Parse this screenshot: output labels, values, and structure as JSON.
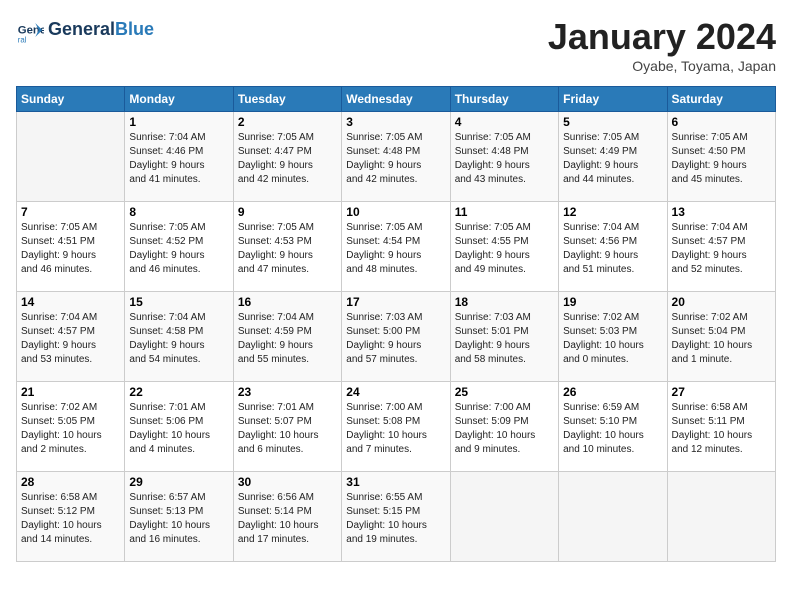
{
  "header": {
    "logo_line1": "General",
    "logo_line2": "Blue",
    "title": "January 2024",
    "subtitle": "Oyabe, Toyama, Japan"
  },
  "days_of_week": [
    "Sunday",
    "Monday",
    "Tuesday",
    "Wednesday",
    "Thursday",
    "Friday",
    "Saturday"
  ],
  "weeks": [
    [
      {
        "num": "",
        "info": ""
      },
      {
        "num": "1",
        "info": "Sunrise: 7:04 AM\nSunset: 4:46 PM\nDaylight: 9 hours\nand 41 minutes."
      },
      {
        "num": "2",
        "info": "Sunrise: 7:05 AM\nSunset: 4:47 PM\nDaylight: 9 hours\nand 42 minutes."
      },
      {
        "num": "3",
        "info": "Sunrise: 7:05 AM\nSunset: 4:48 PM\nDaylight: 9 hours\nand 42 minutes."
      },
      {
        "num": "4",
        "info": "Sunrise: 7:05 AM\nSunset: 4:48 PM\nDaylight: 9 hours\nand 43 minutes."
      },
      {
        "num": "5",
        "info": "Sunrise: 7:05 AM\nSunset: 4:49 PM\nDaylight: 9 hours\nand 44 minutes."
      },
      {
        "num": "6",
        "info": "Sunrise: 7:05 AM\nSunset: 4:50 PM\nDaylight: 9 hours\nand 45 minutes."
      }
    ],
    [
      {
        "num": "7",
        "info": "Sunrise: 7:05 AM\nSunset: 4:51 PM\nDaylight: 9 hours\nand 46 minutes."
      },
      {
        "num": "8",
        "info": "Sunrise: 7:05 AM\nSunset: 4:52 PM\nDaylight: 9 hours\nand 46 minutes."
      },
      {
        "num": "9",
        "info": "Sunrise: 7:05 AM\nSunset: 4:53 PM\nDaylight: 9 hours\nand 47 minutes."
      },
      {
        "num": "10",
        "info": "Sunrise: 7:05 AM\nSunset: 4:54 PM\nDaylight: 9 hours\nand 48 minutes."
      },
      {
        "num": "11",
        "info": "Sunrise: 7:05 AM\nSunset: 4:55 PM\nDaylight: 9 hours\nand 49 minutes."
      },
      {
        "num": "12",
        "info": "Sunrise: 7:04 AM\nSunset: 4:56 PM\nDaylight: 9 hours\nand 51 minutes."
      },
      {
        "num": "13",
        "info": "Sunrise: 7:04 AM\nSunset: 4:57 PM\nDaylight: 9 hours\nand 52 minutes."
      }
    ],
    [
      {
        "num": "14",
        "info": "Sunrise: 7:04 AM\nSunset: 4:57 PM\nDaylight: 9 hours\nand 53 minutes."
      },
      {
        "num": "15",
        "info": "Sunrise: 7:04 AM\nSunset: 4:58 PM\nDaylight: 9 hours\nand 54 minutes."
      },
      {
        "num": "16",
        "info": "Sunrise: 7:04 AM\nSunset: 4:59 PM\nDaylight: 9 hours\nand 55 minutes."
      },
      {
        "num": "17",
        "info": "Sunrise: 7:03 AM\nSunset: 5:00 PM\nDaylight: 9 hours\nand 57 minutes."
      },
      {
        "num": "18",
        "info": "Sunrise: 7:03 AM\nSunset: 5:01 PM\nDaylight: 9 hours\nand 58 minutes."
      },
      {
        "num": "19",
        "info": "Sunrise: 7:02 AM\nSunset: 5:03 PM\nDaylight: 10 hours\nand 0 minutes."
      },
      {
        "num": "20",
        "info": "Sunrise: 7:02 AM\nSunset: 5:04 PM\nDaylight: 10 hours\nand 1 minute."
      }
    ],
    [
      {
        "num": "21",
        "info": "Sunrise: 7:02 AM\nSunset: 5:05 PM\nDaylight: 10 hours\nand 2 minutes."
      },
      {
        "num": "22",
        "info": "Sunrise: 7:01 AM\nSunset: 5:06 PM\nDaylight: 10 hours\nand 4 minutes."
      },
      {
        "num": "23",
        "info": "Sunrise: 7:01 AM\nSunset: 5:07 PM\nDaylight: 10 hours\nand 6 minutes."
      },
      {
        "num": "24",
        "info": "Sunrise: 7:00 AM\nSunset: 5:08 PM\nDaylight: 10 hours\nand 7 minutes."
      },
      {
        "num": "25",
        "info": "Sunrise: 7:00 AM\nSunset: 5:09 PM\nDaylight: 10 hours\nand 9 minutes."
      },
      {
        "num": "26",
        "info": "Sunrise: 6:59 AM\nSunset: 5:10 PM\nDaylight: 10 hours\nand 10 minutes."
      },
      {
        "num": "27",
        "info": "Sunrise: 6:58 AM\nSunset: 5:11 PM\nDaylight: 10 hours\nand 12 minutes."
      }
    ],
    [
      {
        "num": "28",
        "info": "Sunrise: 6:58 AM\nSunset: 5:12 PM\nDaylight: 10 hours\nand 14 minutes."
      },
      {
        "num": "29",
        "info": "Sunrise: 6:57 AM\nSunset: 5:13 PM\nDaylight: 10 hours\nand 16 minutes."
      },
      {
        "num": "30",
        "info": "Sunrise: 6:56 AM\nSunset: 5:14 PM\nDaylight: 10 hours\nand 17 minutes."
      },
      {
        "num": "31",
        "info": "Sunrise: 6:55 AM\nSunset: 5:15 PM\nDaylight: 10 hours\nand 19 minutes."
      },
      {
        "num": "",
        "info": ""
      },
      {
        "num": "",
        "info": ""
      },
      {
        "num": "",
        "info": ""
      }
    ]
  ]
}
